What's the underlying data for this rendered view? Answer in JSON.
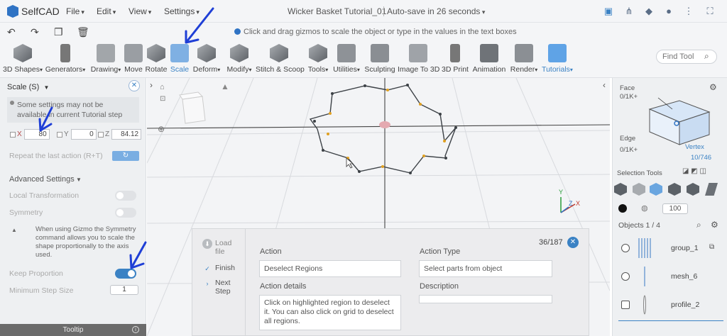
{
  "app": {
    "logo_text": "SelfCAD",
    "menus": [
      "File",
      "Edit",
      "View",
      "Settings"
    ],
    "document_title": "Wicker Basket Tutorial_01",
    "autosave": "Auto-save in 26 seconds"
  },
  "hint": "Click and drag gizmos to scale the object or type in the values in the text boxes",
  "toolbar": {
    "tools": [
      {
        "label": "3D Shapes",
        "dropdown": true
      },
      {
        "label": "Generators",
        "dropdown": true
      },
      {
        "label": "Drawing",
        "dropdown": true
      },
      {
        "label": "Move",
        "dropdown": false
      },
      {
        "label": "Rotate",
        "dropdown": false
      },
      {
        "label": "Scale",
        "dropdown": false,
        "active": true
      },
      {
        "label": "Deform",
        "dropdown": true
      },
      {
        "label": "Modify",
        "dropdown": true
      },
      {
        "label": "Stitch & Scoop",
        "dropdown": false
      },
      {
        "label": "Tools",
        "dropdown": true
      },
      {
        "label": "Utilities",
        "dropdown": true
      },
      {
        "label": "Sculpting",
        "dropdown": false
      },
      {
        "label": "Image To 3D",
        "dropdown": false
      },
      {
        "label": "3D Print",
        "dropdown": false
      },
      {
        "label": "Animation",
        "dropdown": false
      },
      {
        "label": "Render",
        "dropdown": true
      },
      {
        "label": "Tutorials",
        "dropdown": true,
        "active": true
      }
    ],
    "find_placeholder": "Find Tool"
  },
  "left_panel": {
    "title": "Scale (S)",
    "note": "Some settings may not be available in current Tutorial step",
    "axes": [
      {
        "axis": "X",
        "value": "80"
      },
      {
        "axis": "Y",
        "value": "0"
      },
      {
        "axis": "Z",
        "value": "84.12"
      }
    ],
    "repeat_label": "Repeat the last action (R+T)",
    "advanced_settings": "Advanced Settings",
    "local_transformation": "Local Transformation",
    "symmetry": "Symmetry",
    "symmetry_text": "When using Gizmo the Symmetry command allows you to scale the shape proportionally to the axis used.",
    "keep_proportion": "Keep Proportion",
    "keep_proportion_on": true,
    "minimum_step_size": "Minimum Step Size",
    "min_step_value": "1",
    "tooltip": "Tooltip"
  },
  "tutorial": {
    "steps": [
      "Load file",
      "Finish",
      "Next Step"
    ],
    "counter": "36/187",
    "action_label": "Action",
    "action_value": "Deselect Regions",
    "action_type_label": "Action Type",
    "action_type_value": "Select parts from object",
    "details_label": "Action details",
    "details_value": "Click on highlighted region to deselect it. You can also click on grid to deselect all regions.",
    "description_label": "Description"
  },
  "right_panel": {
    "face_label": "Face",
    "face_count": "0/1K+",
    "edge_label": "Edge",
    "edge_count": "0/1K+",
    "vertex_label": "Vertex",
    "vertex_count": "10/746",
    "selection_tools": "Selection Tools",
    "brush_size": "100",
    "objects_header": "Objects 1 / 4",
    "objects": [
      {
        "name": "group_1"
      },
      {
        "name": "mesh_6"
      },
      {
        "name": "profile_2"
      }
    ]
  },
  "gizmo_axes": {
    "x": "X",
    "y": "Y",
    "z": "Z"
  },
  "colors": {
    "accent": "#3b82c4",
    "annotation": "#1f3fd6",
    "vertex": "#e0a020"
  }
}
